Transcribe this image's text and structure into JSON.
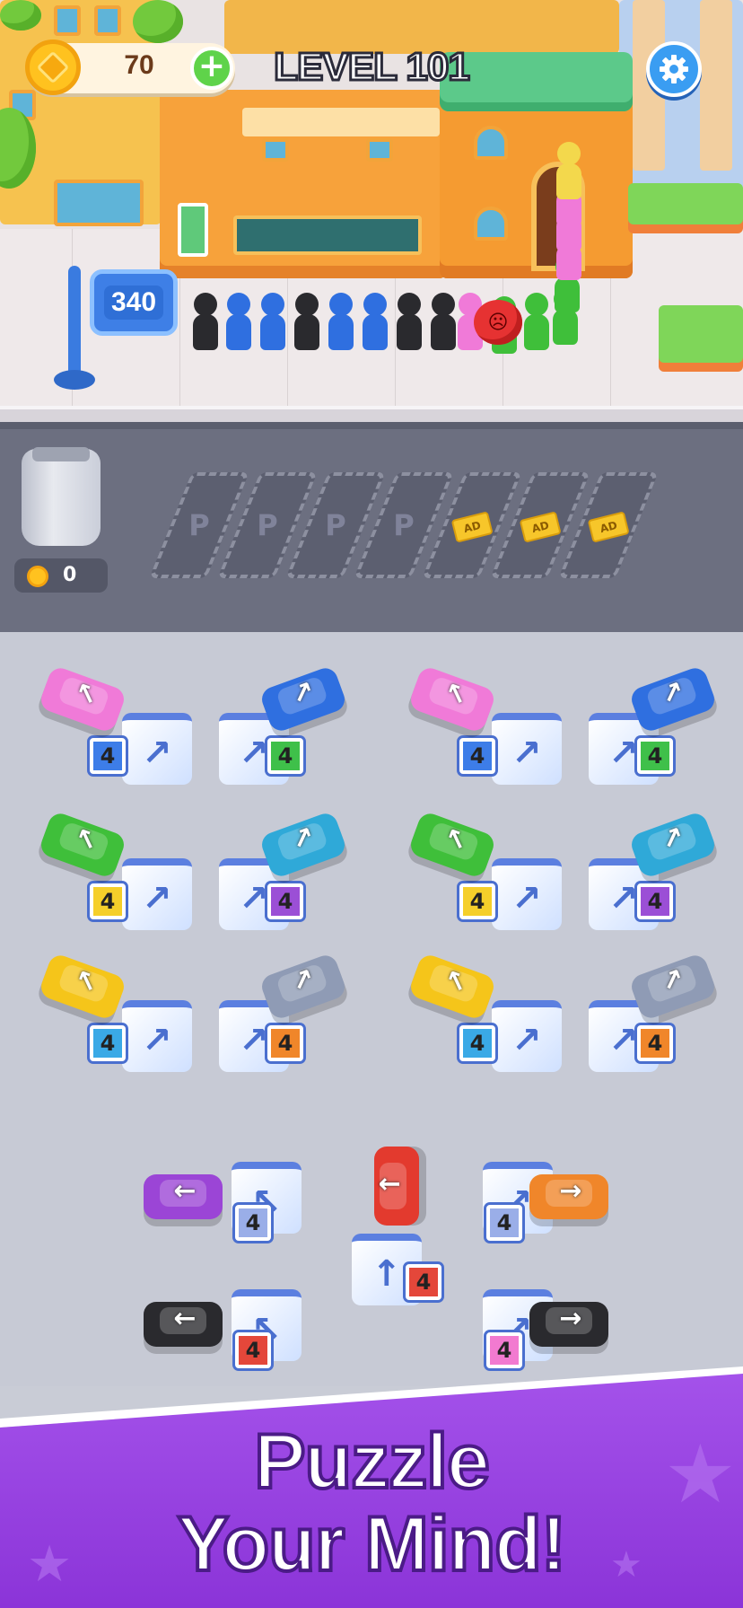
{
  "hud": {
    "coins": "70",
    "level": "LEVEL 101",
    "plus_label": "+",
    "settings_icon": "gear-icon"
  },
  "town": {
    "queue_sign": "340"
  },
  "parking": {
    "jar_coins": "0",
    "slots": [
      {
        "type": "open",
        "label": "P"
      },
      {
        "type": "open",
        "label": "P"
      },
      {
        "type": "open",
        "label": "P"
      },
      {
        "type": "open",
        "label": "P"
      },
      {
        "type": "ad",
        "label": "AD"
      },
      {
        "type": "ad",
        "label": "AD"
      },
      {
        "type": "ad",
        "label": "AD"
      }
    ]
  },
  "garages": {
    "row1": [
      "4",
      "4",
      "4",
      "4"
    ],
    "row2": [
      "4",
      "4",
      "4",
      "4"
    ],
    "row3": [
      "4",
      "4",
      "4",
      "4"
    ],
    "bottom": [
      "4",
      "4",
      "4",
      "4",
      "4"
    ]
  },
  "colors": {
    "pink": "#f07ad8",
    "blue": "#2f6fe0",
    "green": "#3fbf3a",
    "cyan": "#2fa9d8",
    "yellow": "#f5c51a",
    "gray": "#8f9bb5",
    "purple": "#9b45d6",
    "orange": "#f0862a",
    "red": "#e33a2e",
    "black": "#2a2a2e"
  },
  "banner": {
    "line1": "Puzzle",
    "line2": "Your Mind!"
  }
}
